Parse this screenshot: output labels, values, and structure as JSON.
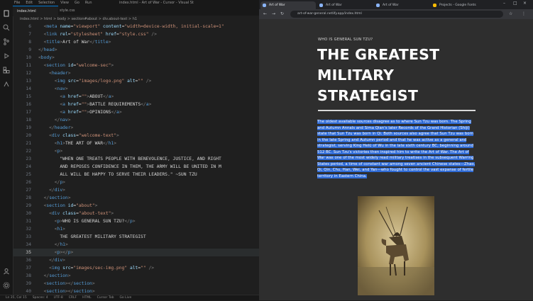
{
  "vscode": {
    "title_menu": [
      "File",
      "Edit",
      "Selection",
      "View",
      "Go",
      "Run"
    ],
    "window_title": "index.html - Art of War - Cursor - Visual St",
    "tabs": [
      "index.html",
      "style.css"
    ],
    "breadcrumb": "index.html > html > body > section#about > div.about-text > h1",
    "lines": [
      {
        "n": "6",
        "segs": [
          [
            "x",
            "  "
          ],
          [
            "p",
            "<"
          ],
          [
            "t",
            "meta "
          ],
          [
            "a",
            "name"
          ],
          [
            "x",
            "="
          ],
          [
            "s",
            "\"viewport\" "
          ],
          [
            "a",
            "content"
          ],
          [
            "x",
            "="
          ],
          [
            "s",
            "\"width=device-width, initial-scale=1\""
          ]
        ]
      },
      {
        "n": "7",
        "segs": [
          [
            "x",
            "  "
          ],
          [
            "p",
            "<"
          ],
          [
            "t",
            "link "
          ],
          [
            "a",
            "rel"
          ],
          [
            "x",
            "="
          ],
          [
            "s",
            "\"stylesheet\" "
          ],
          [
            "a",
            "href"
          ],
          [
            "x",
            "="
          ],
          [
            "s",
            "\"style.css\""
          ],
          [
            "x",
            " "
          ],
          [
            "p",
            "/>"
          ]
        ]
      },
      {
        "n": "8",
        "segs": [
          [
            "x",
            "  "
          ],
          [
            "p",
            "<"
          ],
          [
            "t",
            "title"
          ],
          [
            "p",
            ">"
          ],
          [
            "x",
            "Art of War"
          ],
          [
            "p",
            "</"
          ],
          [
            "t",
            "title"
          ],
          [
            "p",
            ">"
          ]
        ]
      },
      {
        "n": "9",
        "segs": [
          [
            "p",
            "</"
          ],
          [
            "t",
            "head"
          ],
          [
            "p",
            ">"
          ]
        ]
      },
      {
        "n": "10",
        "segs": [
          [
            "p",
            "<"
          ],
          [
            "t",
            "body"
          ],
          [
            "p",
            ">"
          ]
        ]
      },
      {
        "n": "11",
        "segs": [
          [
            "x",
            "  "
          ],
          [
            "p",
            "<"
          ],
          [
            "t",
            "section "
          ],
          [
            "a",
            "id"
          ],
          [
            "x",
            "="
          ],
          [
            "s",
            "\"welcome-sec\""
          ],
          [
            "p",
            ">"
          ]
        ]
      },
      {
        "n": "12",
        "segs": [
          [
            "x",
            "    "
          ],
          [
            "p",
            "<"
          ],
          [
            "t",
            "header"
          ],
          [
            "p",
            ">"
          ]
        ]
      },
      {
        "n": "13",
        "segs": [
          [
            "x",
            "      "
          ],
          [
            "p",
            "<"
          ],
          [
            "t",
            "img "
          ],
          [
            "a",
            "src"
          ],
          [
            "x",
            "="
          ],
          [
            "s",
            "\"images/logo.png\" "
          ],
          [
            "a",
            "alt"
          ],
          [
            "x",
            "="
          ],
          [
            "s",
            "\"\""
          ],
          [
            "x",
            " "
          ],
          [
            "p",
            "/>"
          ]
        ]
      },
      {
        "n": "14",
        "segs": [
          [
            "x",
            "      "
          ],
          [
            "p",
            "<"
          ],
          [
            "t",
            "nav"
          ],
          [
            "p",
            ">"
          ]
        ]
      },
      {
        "n": "15",
        "segs": [
          [
            "x",
            "        "
          ],
          [
            "p",
            "<"
          ],
          [
            "t",
            "a "
          ],
          [
            "a",
            "href"
          ],
          [
            "x",
            "="
          ],
          [
            "s",
            "\"\""
          ],
          [
            "p",
            ">"
          ],
          [
            "x",
            "ABOUT"
          ],
          [
            "p",
            "</"
          ],
          [
            "t",
            "a"
          ],
          [
            "p",
            ">"
          ]
        ]
      },
      {
        "n": "16",
        "segs": [
          [
            "x",
            "        "
          ],
          [
            "p",
            "<"
          ],
          [
            "t",
            "a "
          ],
          [
            "a",
            "href"
          ],
          [
            "x",
            "="
          ],
          [
            "s",
            "\"\""
          ],
          [
            "p",
            ">"
          ],
          [
            "x",
            "BATTLE REQUIREMENTS"
          ],
          [
            "p",
            "</"
          ],
          [
            "t",
            "a"
          ],
          [
            "p",
            ">"
          ]
        ]
      },
      {
        "n": "17",
        "segs": [
          [
            "x",
            "        "
          ],
          [
            "p",
            "<"
          ],
          [
            "t",
            "a "
          ],
          [
            "a",
            "href"
          ],
          [
            "x",
            "="
          ],
          [
            "s",
            "\"\""
          ],
          [
            "p",
            ">"
          ],
          [
            "x",
            "OPINIONS"
          ],
          [
            "p",
            "</"
          ],
          [
            "t",
            "a"
          ],
          [
            "p",
            ">"
          ]
        ]
      },
      {
        "n": "18",
        "segs": [
          [
            "x",
            "      "
          ],
          [
            "p",
            "</"
          ],
          [
            "t",
            "nav"
          ],
          [
            "p",
            ">"
          ]
        ]
      },
      {
        "n": "19",
        "segs": [
          [
            "x",
            "    "
          ],
          [
            "p",
            "</"
          ],
          [
            "t",
            "header"
          ],
          [
            "p",
            ">"
          ]
        ]
      },
      {
        "n": "20",
        "segs": [
          [
            "x",
            "    "
          ],
          [
            "p",
            "<"
          ],
          [
            "t",
            "div "
          ],
          [
            "a",
            "class"
          ],
          [
            "x",
            "="
          ],
          [
            "s",
            "\"welcome-text\""
          ],
          [
            "p",
            ">"
          ]
        ]
      },
      {
        "n": "21",
        "segs": [
          [
            "x",
            "      "
          ],
          [
            "p",
            "<"
          ],
          [
            "t",
            "h1"
          ],
          [
            "p",
            ">"
          ],
          [
            "x",
            "THE ART OF WAR"
          ],
          [
            "p",
            "</"
          ],
          [
            "t",
            "h1"
          ],
          [
            "p",
            ">"
          ]
        ]
      },
      {
        "n": "22",
        "segs": [
          [
            "x",
            "      "
          ],
          [
            "p",
            "<"
          ],
          [
            "t",
            "p"
          ],
          [
            "p",
            ">"
          ]
        ]
      },
      {
        "n": "23",
        "segs": [
          [
            "x",
            "        \"WHEN ONE TREATS PEOPLE WITH BENEVOLENCE, JUSTICE, AND RIGHT"
          ]
        ]
      },
      {
        "n": "24",
        "segs": [
          [
            "x",
            "        AND REPOSES CONFIDENCE IN THEM, THE ARMY WILL BE UNITED IN M"
          ]
        ]
      },
      {
        "n": "25",
        "segs": [
          [
            "x",
            "        ALL WILL BE HAPPY TO SERVE THEIR LEADERS.\" ~SUN TZU"
          ]
        ]
      },
      {
        "n": "26",
        "segs": [
          [
            "x",
            "      "
          ],
          [
            "p",
            "</"
          ],
          [
            "t",
            "p"
          ],
          [
            "p",
            ">"
          ]
        ]
      },
      {
        "n": "27",
        "segs": [
          [
            "x",
            "    "
          ],
          [
            "p",
            "</"
          ],
          [
            "t",
            "div"
          ],
          [
            "p",
            ">"
          ]
        ]
      },
      {
        "n": "28",
        "segs": [
          [
            "x",
            "  "
          ],
          [
            "p",
            "</"
          ],
          [
            "t",
            "section"
          ],
          [
            "p",
            ">"
          ]
        ]
      },
      {
        "n": "29",
        "segs": [
          [
            "x",
            "  "
          ],
          [
            "p",
            "<"
          ],
          [
            "t",
            "section "
          ],
          [
            "a",
            "id"
          ],
          [
            "x",
            "="
          ],
          [
            "s",
            "\"about\""
          ],
          [
            "p",
            ">"
          ]
        ]
      },
      {
        "n": "30",
        "segs": [
          [
            "x",
            "    "
          ],
          [
            "p",
            "<"
          ],
          [
            "t",
            "div "
          ],
          [
            "a",
            "class"
          ],
          [
            "x",
            "="
          ],
          [
            "s",
            "\"about-text\""
          ],
          [
            "p",
            ">"
          ]
        ]
      },
      {
        "n": "31",
        "segs": [
          [
            "x",
            "      "
          ],
          [
            "p",
            "<"
          ],
          [
            "t",
            "p"
          ],
          [
            "p",
            ">"
          ],
          [
            "x",
            "WHO IS GENERAL SUN TZU?"
          ],
          [
            "p",
            "</"
          ],
          [
            "t",
            "p"
          ],
          [
            "p",
            ">"
          ]
        ]
      },
      {
        "n": "32",
        "segs": [
          [
            "x",
            "      "
          ],
          [
            "p",
            "<"
          ],
          [
            "t",
            "h1"
          ],
          [
            "p",
            ">"
          ]
        ]
      },
      {
        "n": "33",
        "segs": [
          [
            "x",
            "        THE GREATEST MILITARY STRATEGIST"
          ]
        ]
      },
      {
        "n": "34",
        "segs": [
          [
            "x",
            "      "
          ],
          [
            "p",
            "</"
          ],
          [
            "t",
            "h1"
          ],
          [
            "p",
            ">"
          ]
        ]
      },
      {
        "n": "35",
        "segs": [
          [
            "x",
            "      "
          ],
          [
            "p",
            "<"
          ],
          [
            "t",
            "p"
          ],
          [
            "p",
            "></"
          ],
          [
            "t",
            "p"
          ],
          [
            "p",
            ">"
          ]
        ]
      },
      {
        "n": "36",
        "segs": [
          [
            "x",
            "    "
          ],
          [
            "p",
            "</"
          ],
          [
            "t",
            "div"
          ],
          [
            "p",
            ">"
          ]
        ]
      },
      {
        "n": "37",
        "segs": [
          [
            "x",
            "    "
          ],
          [
            "p",
            "<"
          ],
          [
            "t",
            "img "
          ],
          [
            "a",
            "src"
          ],
          [
            "x",
            "="
          ],
          [
            "s",
            "\"images/sec-img.png\" "
          ],
          [
            "a",
            "alt"
          ],
          [
            "x",
            "="
          ],
          [
            "s",
            "\"\""
          ],
          [
            "x",
            " "
          ],
          [
            "p",
            "/>"
          ]
        ]
      },
      {
        "n": "38",
        "segs": [
          [
            "x",
            "  "
          ],
          [
            "p",
            "</"
          ],
          [
            "t",
            "section"
          ],
          [
            "p",
            ">"
          ]
        ]
      },
      {
        "n": "39",
        "segs": [
          [
            "x",
            "  "
          ],
          [
            "p",
            "<"
          ],
          [
            "t",
            "section"
          ],
          [
            "p",
            "></"
          ],
          [
            "t",
            "section"
          ],
          [
            "p",
            ">"
          ]
        ]
      },
      {
        "n": "40",
        "segs": [
          [
            "x",
            "  "
          ],
          [
            "p",
            "<"
          ],
          [
            "t",
            "section"
          ],
          [
            "p",
            "></"
          ],
          [
            "t",
            "section"
          ],
          [
            "p",
            ">"
          ]
        ]
      },
      {
        "n": "41",
        "segs": [
          [
            "p",
            "</"
          ],
          [
            "t",
            "body"
          ],
          [
            "p",
            ">"
          ]
        ]
      }
    ],
    "status": [
      "Ln 35, Col 15",
      "Spaces: 4",
      "UTF-8",
      "CRLF",
      "HTML",
      "Cursor Tab",
      "Go Live"
    ]
  },
  "browser": {
    "tabs": [
      "Art of War",
      "Art of War",
      "Art of War",
      "Projects - Google Fonts"
    ],
    "url": "art-of-war-general.netlify.app/index.html",
    "page": {
      "kicker": "WHO IS GENERAL SUN TZU?",
      "headline": "THE GREATEST MILITARY STRATEGIST",
      "paragraph": "The oldest available sources disagree as to where Sun Tzu was born. The Spring and Autumn Annals and Sima Qian's later Records of the Grand Historian (Shiji) state that Sun Tzu was born in Qi. Both sources also agree that Sun Tzu was born in the late Spring and Autumn period and that he was active as a general and strategist, serving King Helü of Wu in the late sixth century BC, beginning around 512 BC. Sun Tzu's victories then inspired him to write the Art of War. The Art of War was one of the most widely read military treatises in the subsequent Warring States period, a time of constant war among seven ancient Chinese states—Zhao, Qi, Qin, Chu, Han, Wei, and Yan—who fought to control the vast expanse of fertile territory in Eastern China."
    }
  },
  "colors": {
    "accent": "#0078d4",
    "highlight": "#2f6bd6"
  }
}
